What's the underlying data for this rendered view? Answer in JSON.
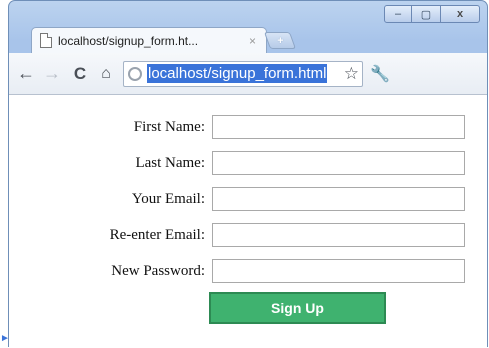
{
  "window": {
    "controls": {
      "minimize": "–",
      "maximize": "▢",
      "close": "x"
    }
  },
  "tab": {
    "title": "localhost/signup_form.ht...",
    "close": "×"
  },
  "new_tab_label": "+",
  "toolbar": {
    "url": "localhost/signup_form.html"
  },
  "form": {
    "fields": [
      {
        "label": "First Name:",
        "value": ""
      },
      {
        "label": "Last Name:",
        "value": ""
      },
      {
        "label": "Your Email:",
        "value": ""
      },
      {
        "label": "Re-enter Email:",
        "value": ""
      },
      {
        "label": "New Password:",
        "value": ""
      }
    ],
    "submit_label": "Sign Up"
  },
  "colors": {
    "accent": "#3a73d9",
    "button_green": "#3fb26f"
  }
}
